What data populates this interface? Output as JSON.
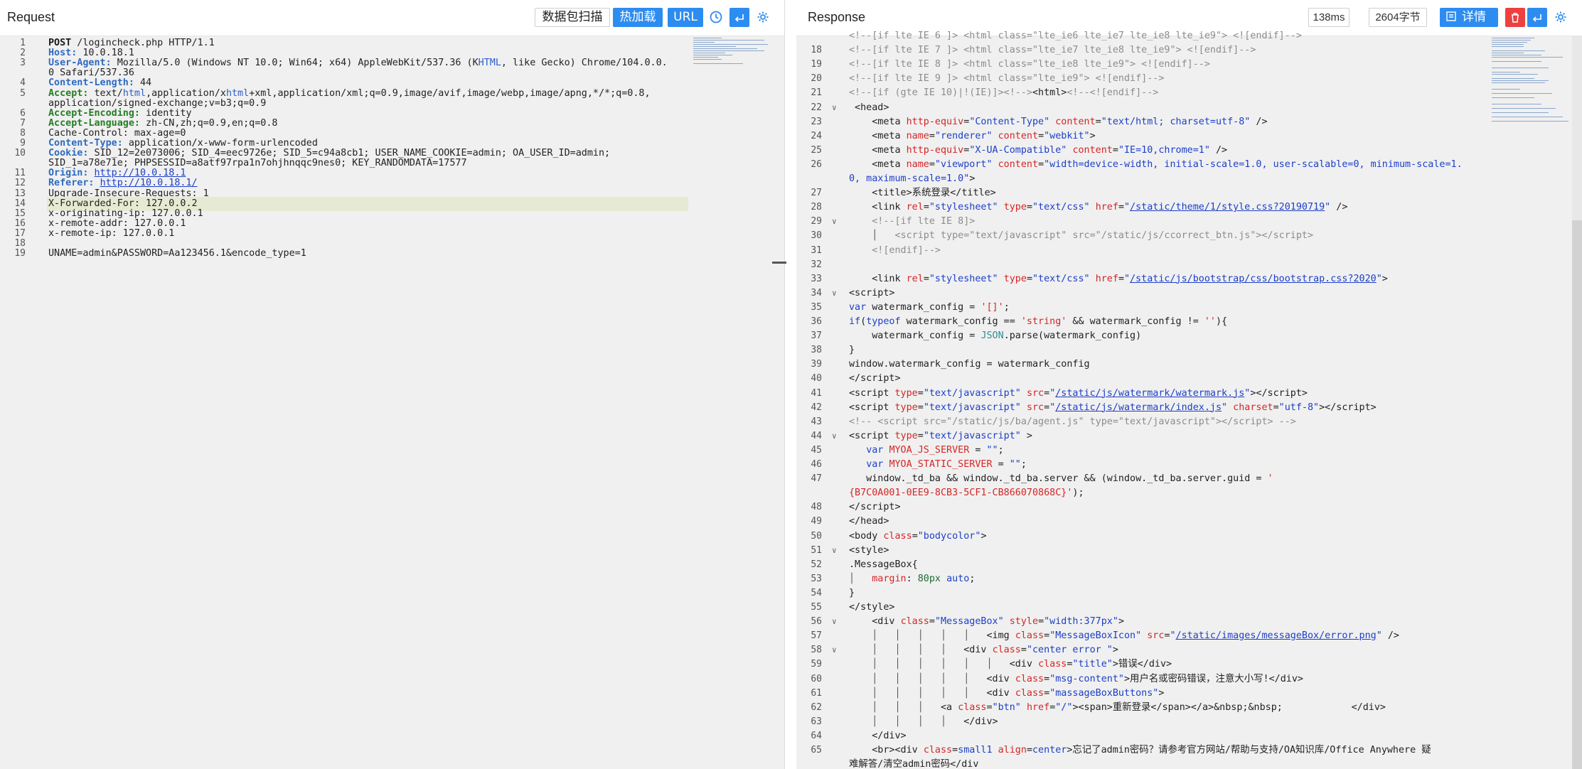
{
  "request": {
    "title": "Request",
    "buttons": {
      "scan": "数据包扫描",
      "hot_load": "热加载",
      "url": "URL"
    },
    "icons": [
      "history-icon",
      "wrap-icon",
      "gear-icon"
    ],
    "lines": [
      {
        "n": "1",
        "html": "<span class='kw'>POST</span> /logincheck.php HTTP/1.1"
      },
      {
        "n": "2",
        "html": "<span class='hk'>Host:</span> 10.0.18.1"
      },
      {
        "n": "3",
        "html": "<span class='hk'>User-Agent:</span> Mozilla/5.0 (Windows NT 10.0; Win64; x64) AppleWebKit/537.36 (K<span class='bl'>HTML</span>, like Gecko) Chrome/104.0.0."
      },
      {
        "n": "",
        "html": "0 Safari/537.36"
      },
      {
        "n": "4",
        "html": "<span class='hk'>Content-Length:</span> 44"
      },
      {
        "n": "5",
        "html": "<span class='gk'>Accept:</span> text/<span class='bl'>html</span>,application/x<span class='bl'>html</span>+xml,application/xml;q=0.9,image/avif,image/webp,image/apng,*/*;q=0.8,"
      },
      {
        "n": "",
        "html": "application/signed-exchange;v=b3;q=0.9"
      },
      {
        "n": "6",
        "html": "<span class='gk'>Accept-Encoding:</span> identity"
      },
      {
        "n": "7",
        "html": "<span class='gk'>Accept-Language:</span> zh-CN,zh;q=0.9,en;q=0.8"
      },
      {
        "n": "8",
        "html": "Cache-Control: max-age=0"
      },
      {
        "n": "9",
        "html": "<span class='hk'>Content-Type:</span> application/x-www-form-urlencoded"
      },
      {
        "n": "10",
        "html": "<span class='hk'>Cookie:</span> SID_12=2e073006; SID_4=eec9726e; SID_5=c94a8cb1; USER_NAME_COOKIE=admin; OA_USER_ID=admin;"
      },
      {
        "n": "",
        "html": "SID_1=a78e71e; PHPSESSID=a8atf97rpa1n7ohjhnqqc9nes0; KEY_RANDOMDATA=17577"
      },
      {
        "n": "11",
        "html": "<span class='hk'>Origin:</span> <span class='lk'>http://10.0.18.1</span>"
      },
      {
        "n": "12",
        "html": "<span class='hk'>Referer:</span> <span class='lk'>http://10.0.18.1/</span>"
      },
      {
        "n": "13",
        "html": "Upgrade-Insecure-Requests: 1"
      },
      {
        "n": "14",
        "html": "X-Forwarded-For: 127.0.0.2",
        "hl": true
      },
      {
        "n": "15",
        "html": "x-originating-ip: 127.0.0.1"
      },
      {
        "n": "16",
        "html": "x-remote-addr: 127.0.0.1"
      },
      {
        "n": "17",
        "html": "x-remote-ip: 127.0.0.1"
      },
      {
        "n": "18",
        "html": ""
      },
      {
        "n": "19",
        "html": "UNAME=admin&amp;PASSWORD=Aa123456.1&amp;encode_type=1"
      }
    ]
  },
  "response": {
    "title": "Response",
    "time": "138ms",
    "size": "2604字节",
    "details": "详情",
    "icons": [
      "details-icon",
      "trash-icon",
      "wrap-icon",
      "gear-icon"
    ],
    "lines": [
      {
        "n": "",
        "html": "<span class='cm'>&lt;!--[if lte IE 6 ]&gt; &lt;html class=\"lte_ie6 lte_ie7 lte_ie8 lte_ie9\"&gt; &lt;![endif]--&gt;</span>"
      },
      {
        "n": "18",
        "html": "<span class='cm'>&lt;!--[if lte IE 7 ]&gt; &lt;html class=\"lte_ie7 lte_ie8 lte_ie9\"&gt; &lt;![endif]--&gt;</span>"
      },
      {
        "n": "19",
        "html": "<span class='cm'>&lt;!--[if lte IE 8 ]&gt; &lt;html class=\"lte_ie8 lte_ie9\"&gt; &lt;![endif]--&gt;</span>"
      },
      {
        "n": "20",
        "html": "<span class='cm'>&lt;!--[if lte IE 9 ]&gt; &lt;html class=\"lte_ie9\"&gt; &lt;![endif]--&gt;</span>"
      },
      {
        "n": "21",
        "html": "<span class='cm'>&lt;!--[if (gte IE 10)|!(IE)]&gt;&lt;!--&gt;</span>&lt;html&gt;<span class='cm'>&lt;!--&lt;![endif]--&gt;</span>"
      },
      {
        "n": "22",
        "fold": true,
        "html": " &lt;head&gt;"
      },
      {
        "n": "23",
        "html": "    &lt;meta <span class='an'>http-equiv</span>=<span class='av'>\"Content-Type\"</span> <span class='an'>content</span>=<span class='av'>\"text/html; charset=utf-8\"</span> /&gt;"
      },
      {
        "n": "24",
        "html": "    &lt;meta <span class='an'>name</span>=<span class='av'>\"renderer\"</span> <span class='an'>content</span>=<span class='av'>\"webkit\"</span>&gt;"
      },
      {
        "n": "25",
        "html": "    &lt;meta <span class='an'>http-equiv</span>=<span class='av'>\"X-UA-Compatible\"</span> <span class='an'>content</span>=<span class='av'>\"IE=10,chrome=1\"</span> /&gt;"
      },
      {
        "n": "26",
        "html": "    &lt;meta <span class='an'>name</span>=<span class='av'>\"viewport\"</span> <span class='an'>content</span>=<span class='av'>\"width=device-width, initial-scale=1.0, user-scalable=0, minimum-scale=1.</span>"
      },
      {
        "n": "",
        "html": "<span class='av'>0, maximum-scale=1.0\"</span>&gt;"
      },
      {
        "n": "27",
        "html": "    &lt;title&gt;系统登录&lt;/title&gt;"
      },
      {
        "n": "28",
        "html": "    &lt;link <span class='an'>rel</span>=<span class='av'>\"stylesheet\"</span> <span class='an'>type</span>=<span class='av'>\"text/css\"</span> <span class='an'>href</span>=<span class='av'>\"</span><span class='lk'>/static/theme/1/style.css?20190719</span><span class='av'>\"</span> /&gt;"
      },
      {
        "n": "29",
        "fold": true,
        "html": "    <span class='cm'>&lt;!--[if lte IE 8]&gt;</span>"
      },
      {
        "n": "30",
        "html": "    <span class='gl'>│</span>   <span class='cm'>&lt;script type=\"text/javascript\" src=\"/static/js/ccorrect_btn.js\"&gt;&lt;/script&gt;</span>"
      },
      {
        "n": "31",
        "html": "    <span class='cm'>&lt;![endif]--&gt;</span>"
      },
      {
        "n": "32",
        "html": ""
      },
      {
        "n": "33",
        "html": "    &lt;link <span class='an'>rel</span>=<span class='av'>\"stylesheet\"</span> <span class='an'>type</span>=<span class='av'>\"text/css\"</span> <span class='an'>href</span>=<span class='av'>\"</span><span class='lk'>/static/js/bootstrap/css/bootstrap.css?2020</span><span class='av'>\"</span>&gt;"
      },
      {
        "n": "34",
        "fold": true,
        "html": "&lt;script&gt;"
      },
      {
        "n": "35",
        "html": "<span class='kwd'>var</span> watermark_config = <span class='an'>'[]'</span>;"
      },
      {
        "n": "36",
        "html": "<span class='kwd'>if</span>(<span class='kwd'>typeof</span> watermark_config == <span class='an'>'string'</span> &amp;&amp; watermark_config != <span class='an'>''</span>){"
      },
      {
        "n": "37",
        "html": "    watermark_config = <span class='jsn'>JSON</span>.parse(watermark_config)"
      },
      {
        "n": "38",
        "html": "}"
      },
      {
        "n": "39",
        "html": "window.watermark_config = watermark_config"
      },
      {
        "n": "40",
        "html": "&lt;/script&gt;"
      },
      {
        "n": "41",
        "html": "&lt;script <span class='an'>type</span>=<span class='av'>\"text/javascript\"</span> <span class='an'>src</span>=<span class='av'>\"</span><span class='lk'>/static/js/watermark/watermark.js</span><span class='av'>\"</span>&gt;&lt;/script&gt;"
      },
      {
        "n": "42",
        "html": "&lt;script <span class='an'>type</span>=<span class='av'>\"text/javascript\"</span> <span class='an'>src</span>=<span class='av'>\"</span><span class='lk'>/static/js/watermark/index.js</span><span class='av'>\"</span> <span class='an'>charset</span>=<span class='av'>\"utf-8\"</span>&gt;&lt;/script&gt;"
      },
      {
        "n": "43",
        "html": "<span class='cm'>&lt;!-- &lt;script src=\"/static/js/ba/agent.js\" type=\"text/javascript\"&gt;&lt;/script&gt; --&gt;</span>"
      },
      {
        "n": "44",
        "fold": true,
        "html": "&lt;script <span class='an'>type</span>=<span class='av'>\"text/javascript\"</span> &gt;"
      },
      {
        "n": "45",
        "html": "   <span class='kwd'>var</span> <span class='an'>MYOA_JS_SERVER</span> = <span class='av'>\"\"</span>;"
      },
      {
        "n": "46",
        "html": "   <span class='kwd'>var</span> <span class='an'>MYOA_STATIC_SERVER</span> = <span class='av'>\"\"</span>;"
      },
      {
        "n": "47",
        "html": "   window._td_ba &amp;&amp; window._td_ba.server &amp;&amp; (window._td_ba.server.guid = <span class='an'>'</span>"
      },
      {
        "n": "",
        "html": "<span class='an'>{B7C0A001-0EE9-8CB3-5CF1-CB866070868C}'</span>);"
      },
      {
        "n": "48",
        "html": "&lt;/script&gt;"
      },
      {
        "n": "49",
        "html": "&lt;/head&gt;"
      },
      {
        "n": "50",
        "html": "&lt;body <span class='an'>class</span>=<span class='av'>\"bodycolor\"</span>&gt;"
      },
      {
        "n": "51",
        "fold": true,
        "html": "&lt;style&gt;"
      },
      {
        "n": "52",
        "html": ".MessageBox{"
      },
      {
        "n": "53",
        "html": "<span class='gl'>│</span>   <span class='an'>margin</span>: <span class='num'>80px</span> <span class='av'>auto</span>;"
      },
      {
        "n": "54",
        "html": "}"
      },
      {
        "n": "55",
        "html": "&lt;/style&gt;"
      },
      {
        "n": "56",
        "fold": true,
        "html": "    &lt;div <span class='an'>class</span>=<span class='av'>\"MessageBox\"</span> <span class='an'>style</span>=<span class='av'>\"width:377px\"</span>&gt;"
      },
      {
        "n": "57",
        "html": "    <span class='gl'>│   │   │   │   │</span>   &lt;img <span class='an'>class</span>=<span class='av'>\"MessageBoxIcon\"</span> <span class='an'>src</span>=<span class='av'>\"</span><span class='lk'>/static/images/messageBox/error.png</span><span class='av'>\"</span> /&gt;"
      },
      {
        "n": "58",
        "fold": true,
        "html": "    <span class='gl'>│   │   │   │</span>   &lt;div <span class='an'>class</span>=<span class='av'>\"center error \"</span>&gt;"
      },
      {
        "n": "59",
        "html": "    <span class='gl'>│   │   │   │   │   │</span>   &lt;div <span class='an'>class</span>=<span class='av'>\"title\"</span>&gt;错误&lt;/div&gt;"
      },
      {
        "n": "60",
        "html": "    <span class='gl'>│   │   │   │   │</span>   &lt;div <span class='an'>class</span>=<span class='av'>\"msg-content\"</span>&gt;用户名或密码错误，注意大小写!&lt;/div&gt;"
      },
      {
        "n": "61",
        "html": "    <span class='gl'>│   │   │   │   │</span>   &lt;div <span class='an'>class</span>=<span class='av'>\"massageBoxButtons\"</span>&gt;"
      },
      {
        "n": "62",
        "html": "    <span class='gl'>│   │   │</span>   &lt;a <span class='an'>class</span>=<span class='av'>\"btn\"</span> <span class='an'>href</span>=<span class='av'>\"/\"</span>&gt;&lt;span&gt;重新登录&lt;/span&gt;&lt;/a&gt;&amp;nbsp;&amp;nbsp;            &lt;/div&gt;"
      },
      {
        "n": "63",
        "html": "    <span class='gl'>│   │   │   │</span>   &lt;/div&gt;"
      },
      {
        "n": "64",
        "html": "    &lt;/div&gt;"
      },
      {
        "n": "65",
        "html": "    &lt;br&gt;&lt;div <span class='an'>class</span>=<span class='av'>small1</span> <span class='an'>align</span>=<span class='av'>center</span>&gt;忘记了admin密码？请参考官方网站/帮助与支持/OA知识库/Office Anywhere 疑"
      },
      {
        "n": "",
        "html": "难解答/清空admin密码&lt;/div"
      }
    ]
  }
}
